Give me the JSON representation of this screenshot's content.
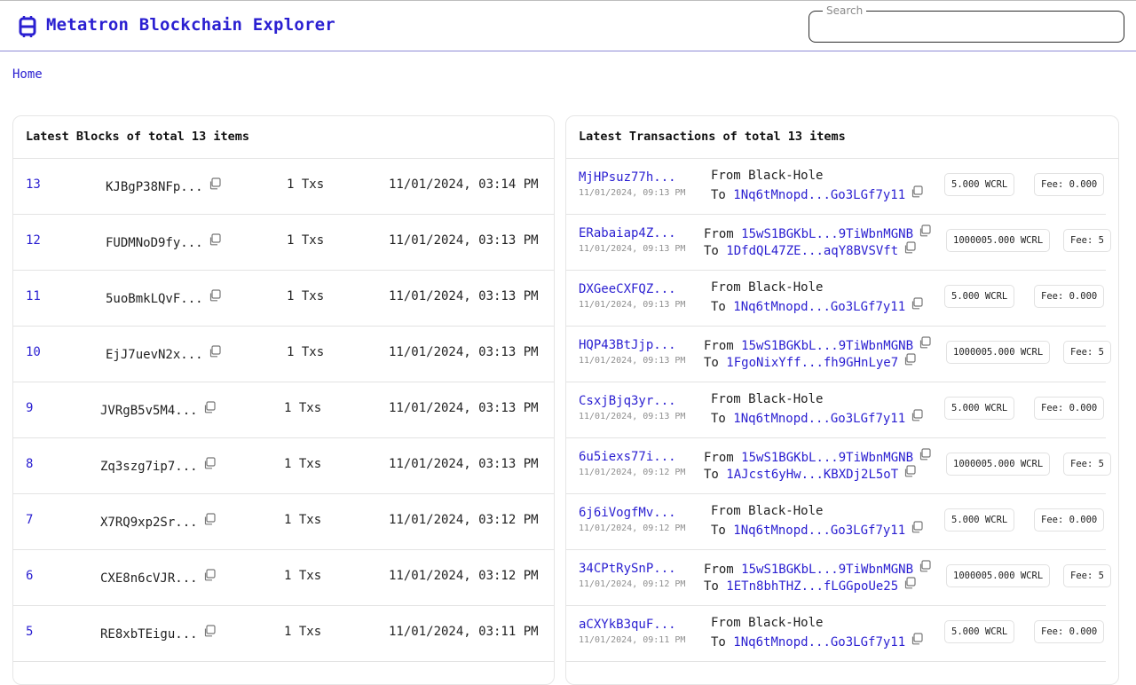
{
  "header": {
    "brand": "Metatron Blockchain Explorer",
    "search_label": "Search",
    "search_value": ""
  },
  "breadcrumb": {
    "home": "Home"
  },
  "blocks": {
    "title": "Latest Blocks of total 13 items",
    "rows": [
      {
        "number": "13",
        "hash": "KJBgP38NFp...",
        "txs": "1 Txs",
        "time": "11/01/2024, 03:14 PM"
      },
      {
        "number": "12",
        "hash": "FUDMNoD9fy...",
        "txs": "1 Txs",
        "time": "11/01/2024, 03:13 PM"
      },
      {
        "number": "11",
        "hash": "5uoBmkLQvF...",
        "txs": "1 Txs",
        "time": "11/01/2024, 03:13 PM"
      },
      {
        "number": "10",
        "hash": "EjJ7uevN2x...",
        "txs": "1 Txs",
        "time": "11/01/2024, 03:13 PM"
      },
      {
        "number": "9",
        "hash": "JVRgB5v5M4...",
        "txs": "1 Txs",
        "time": "11/01/2024, 03:13 PM"
      },
      {
        "number": "8",
        "hash": "Zq3szg7ip7...",
        "txs": "1 Txs",
        "time": "11/01/2024, 03:13 PM"
      },
      {
        "number": "7",
        "hash": "X7RQ9xp2Sr...",
        "txs": "1 Txs",
        "time": "11/01/2024, 03:12 PM"
      },
      {
        "number": "6",
        "hash": "CXE8n6cVJR...",
        "txs": "1 Txs",
        "time": "11/01/2024, 03:12 PM"
      },
      {
        "number": "5",
        "hash": "RE8xbTEigu...",
        "txs": "1 Txs",
        "time": "11/01/2024, 03:11 PM"
      }
    ]
  },
  "transactions": {
    "title": "Latest Transactions of total 13 items",
    "rows": [
      {
        "hash": "MjHPsuz77h...",
        "time": "11/01/2024, 09:13 PM",
        "from_label": "From",
        "from_value": "Black-Hole",
        "from_is_address": false,
        "to_label": "To",
        "to_value": "1Nq6tMnopd...Go3LGf7y11",
        "amount": "5.000 WCRL",
        "fee": "Fee: 0.000"
      },
      {
        "hash": "ERabaiap4Z...",
        "time": "11/01/2024, 09:13 PM",
        "from_label": "From",
        "from_value": "15wS1BGKbL...9TiWbnMGNB",
        "from_is_address": true,
        "to_label": "To",
        "to_value": "1DfdQL47ZE...aqY8BVSVft",
        "amount": "1000005.000 WCRL",
        "fee": "Fee: 5"
      },
      {
        "hash": "DXGeeCXFQZ...",
        "time": "11/01/2024, 09:13 PM",
        "from_label": "From",
        "from_value": "Black-Hole",
        "from_is_address": false,
        "to_label": "To",
        "to_value": "1Nq6tMnopd...Go3LGf7y11",
        "amount": "5.000 WCRL",
        "fee": "Fee: 0.000"
      },
      {
        "hash": "HQP43BtJjp...",
        "time": "11/01/2024, 09:13 PM",
        "from_label": "From",
        "from_value": "15wS1BGKbL...9TiWbnMGNB",
        "from_is_address": true,
        "to_label": "To",
        "to_value": "1FgoNixYff...fh9GHnLye7",
        "amount": "1000005.000 WCRL",
        "fee": "Fee: 5"
      },
      {
        "hash": "CsxjBjq3yr...",
        "time": "11/01/2024, 09:13 PM",
        "from_label": "From",
        "from_value": "Black-Hole",
        "from_is_address": false,
        "to_label": "To",
        "to_value": "1Nq6tMnopd...Go3LGf7y11",
        "amount": "5.000 WCRL",
        "fee": "Fee: 0.000"
      },
      {
        "hash": "6u5iexs77i...",
        "time": "11/01/2024, 09:12 PM",
        "from_label": "From",
        "from_value": "15wS1BGKbL...9TiWbnMGNB",
        "from_is_address": true,
        "to_label": "To",
        "to_value": "1AJcst6yHw...KBXDj2L5oT",
        "amount": "1000005.000 WCRL",
        "fee": "Fee: 5"
      },
      {
        "hash": "6j6iVogfMv...",
        "time": "11/01/2024, 09:12 PM",
        "from_label": "From",
        "from_value": "Black-Hole",
        "from_is_address": false,
        "to_label": "To",
        "to_value": "1Nq6tMnopd...Go3LGf7y11",
        "amount": "5.000 WCRL",
        "fee": "Fee: 0.000"
      },
      {
        "hash": "34CPtRySnP...",
        "time": "11/01/2024, 09:12 PM",
        "from_label": "From",
        "from_value": "15wS1BGKbL...9TiWbnMGNB",
        "from_is_address": true,
        "to_label": "To",
        "to_value": "1ETn8bhTHZ...fLGGpoUe25",
        "amount": "1000005.000 WCRL",
        "fee": "Fee: 5"
      },
      {
        "hash": "aCXYkB3quF...",
        "time": "11/01/2024, 09:11 PM",
        "from_label": "From",
        "from_value": "Black-Hole",
        "from_is_address": false,
        "to_label": "To",
        "to_value": "1Nq6tMnopd...Go3LGf7y11",
        "amount": "5.000 WCRL",
        "fee": "Fee: 0.000"
      }
    ]
  },
  "colors": {
    "accent": "#2a1fd1",
    "muted": "#8f8f8f",
    "divider": "#e3e3e3"
  }
}
